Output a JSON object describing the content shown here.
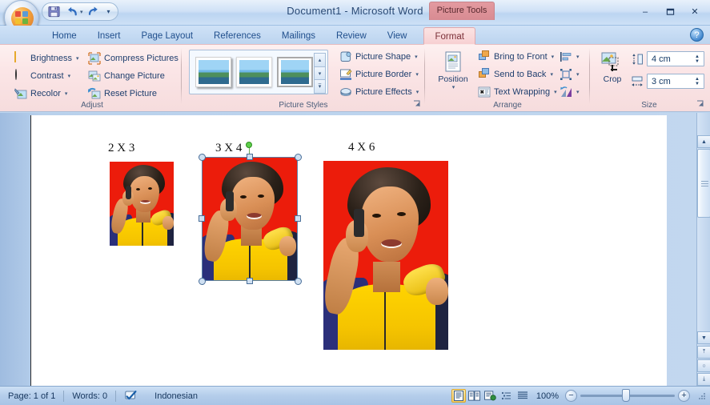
{
  "window": {
    "title": "Document1 - Microsoft Word",
    "contextual_tools_label": "Picture Tools",
    "minimize": "–",
    "maximize": "❐",
    "close": "✕",
    "help": "?"
  },
  "quick_access": {
    "items": [
      {
        "name": "save-icon",
        "glyph": "💾"
      },
      {
        "name": "undo-icon",
        "glyph": "↶"
      },
      {
        "name": "redo-icon",
        "glyph": "↷"
      }
    ],
    "customize_glyph": "▾"
  },
  "tabs": [
    {
      "label": "Home",
      "active": false
    },
    {
      "label": "Insert",
      "active": false
    },
    {
      "label": "Page Layout",
      "active": false
    },
    {
      "label": "References",
      "active": false
    },
    {
      "label": "Mailings",
      "active": false
    },
    {
      "label": "Review",
      "active": false
    },
    {
      "label": "View",
      "active": false
    },
    {
      "label": "Format",
      "active": true
    }
  ],
  "ribbon": {
    "groups": [
      {
        "name": "adjust",
        "label": "Adjust",
        "items": [
          {
            "label": "Brightness",
            "icon": "brightness-icon",
            "dropdown": true
          },
          {
            "label": "Compress Pictures",
            "icon": "compress-pictures-icon",
            "dropdown": false
          },
          {
            "label": "Contrast",
            "icon": "contrast-icon",
            "dropdown": true
          },
          {
            "label": "Change Picture",
            "icon": "change-picture-icon",
            "dropdown": false
          },
          {
            "label": "Recolor",
            "icon": "recolor-icon",
            "dropdown": true
          },
          {
            "label": "Reset Picture",
            "icon": "reset-picture-icon",
            "dropdown": false
          }
        ]
      },
      {
        "name": "picture-styles",
        "label": "Picture Styles",
        "items": [
          {
            "label": "Picture Shape",
            "icon": "picture-shape-icon",
            "dropdown": true
          },
          {
            "label": "Picture Border",
            "icon": "picture-border-icon",
            "dropdown": true
          },
          {
            "label": "Picture Effects",
            "icon": "picture-effects-icon",
            "dropdown": true
          }
        ],
        "gallery_scroll": {
          "up": "▴",
          "down": "▾",
          "more": "▾"
        },
        "dialog_launcher": "⤵"
      },
      {
        "name": "arrange",
        "label": "Arrange",
        "position_label": "Position",
        "items": [
          {
            "label": "Bring to Front",
            "icon": "bring-to-front-icon",
            "dropdown": true
          },
          {
            "label": "Send to Back",
            "icon": "send-to-back-icon",
            "dropdown": true
          },
          {
            "label": "Text Wrapping",
            "icon": "text-wrapping-icon",
            "dropdown": true
          }
        ],
        "minis": [
          {
            "name": "align-icon",
            "dropdown": true
          },
          {
            "name": "group-icon",
            "dropdown": true
          },
          {
            "name": "rotate-icon",
            "dropdown": true
          }
        ]
      },
      {
        "name": "size",
        "label": "Size",
        "crop_label": "Crop",
        "height_value": "4 cm",
        "width_value": "3 cm",
        "dialog_launcher": "⤵"
      }
    ]
  },
  "document": {
    "photos": [
      {
        "label": "2 X 3",
        "selected": false
      },
      {
        "label": "3 X 4",
        "selected": true
      },
      {
        "label": "4 X 6",
        "selected": false
      }
    ]
  },
  "status_bar": {
    "page": "Page: 1 of 1",
    "words": "Words: 0",
    "proofing_icon": "proofing-errors-icon",
    "language": "Indonesian",
    "zoom_level": "100%",
    "zoom_out": "−",
    "zoom_in": "+",
    "views": [
      {
        "name": "print-layout-view",
        "active": true
      },
      {
        "name": "full-screen-reading-view",
        "active": false
      },
      {
        "name": "web-layout-view",
        "active": false
      },
      {
        "name": "outline-view",
        "active": false
      },
      {
        "name": "draft-view",
        "active": false
      }
    ]
  },
  "scrollbar": {
    "up": "▲",
    "down": "▼",
    "previous_page": "⤒",
    "select_browse_object": "○",
    "next_page": "⤓",
    "split": "split-handle"
  },
  "colors": {
    "accent": "#1f4e8c",
    "contextual": "#d88b92",
    "photo_background": "#ec1c0b",
    "selection": "#5b80a8"
  }
}
